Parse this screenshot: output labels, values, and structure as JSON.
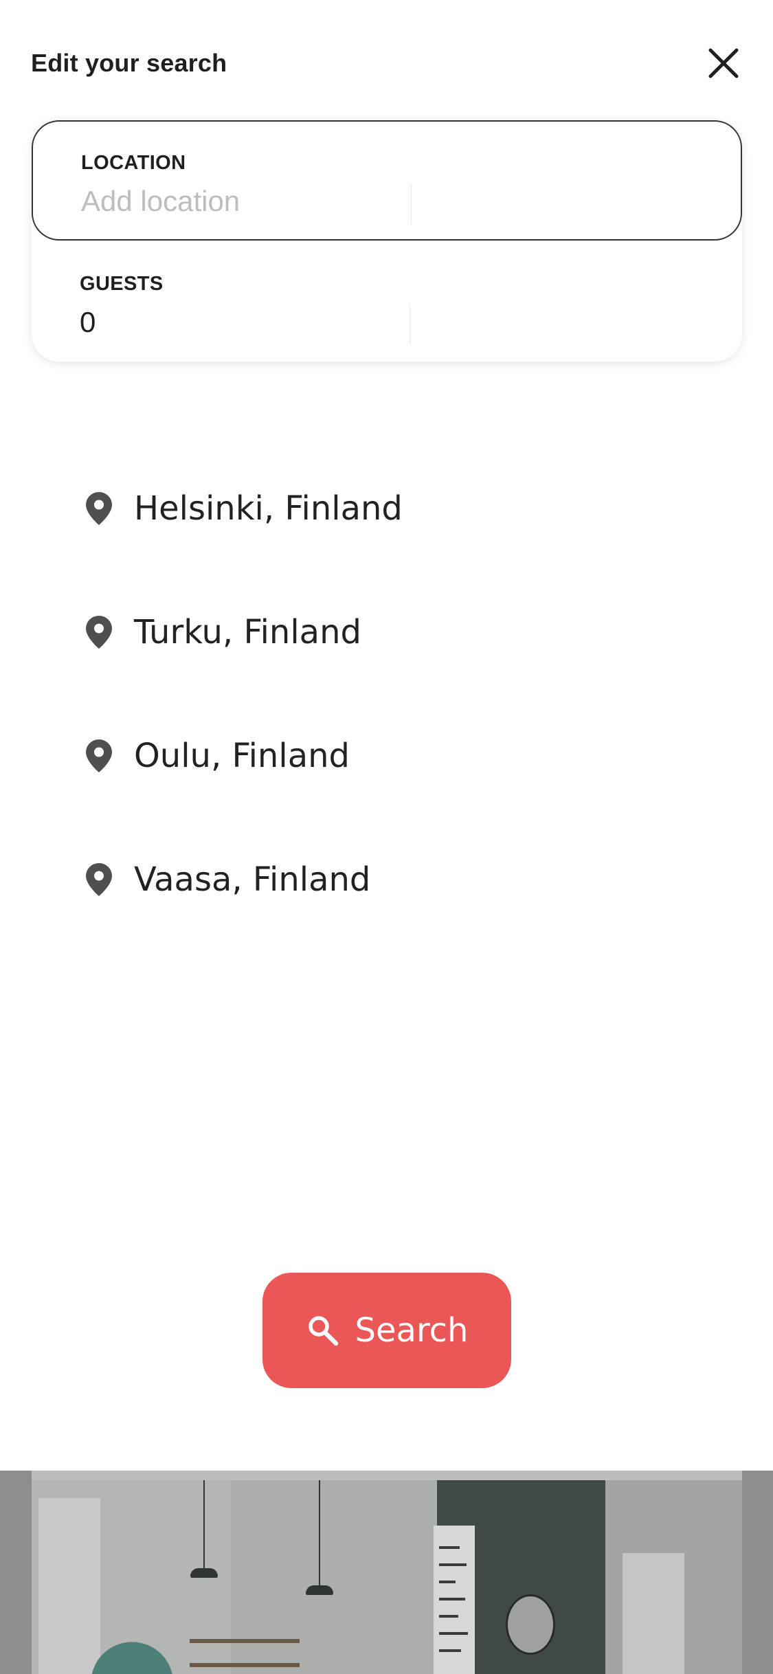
{
  "header": {
    "title": "Edit your search",
    "close_icon": "close-icon"
  },
  "search_form": {
    "location": {
      "label": "LOCATION",
      "value": "",
      "placeholder": "Add location"
    },
    "guests": {
      "label": "GUESTS",
      "value": "0"
    }
  },
  "suggestions": [
    {
      "icon": "map-pin-icon",
      "label": "Helsinki, Finland"
    },
    {
      "icon": "map-pin-icon",
      "label": "Turku, Finland"
    },
    {
      "icon": "map-pin-icon",
      "label": "Oulu, Finland"
    },
    {
      "icon": "map-pin-icon",
      "label": "Vaasa, Finland"
    }
  ],
  "search_button": {
    "label": "Search",
    "icon": "search-icon"
  },
  "colors": {
    "accent": "#eb5757",
    "text": "#1f1f1f",
    "placeholder": "#bdbdbd",
    "icon": "#4f4f4f"
  }
}
